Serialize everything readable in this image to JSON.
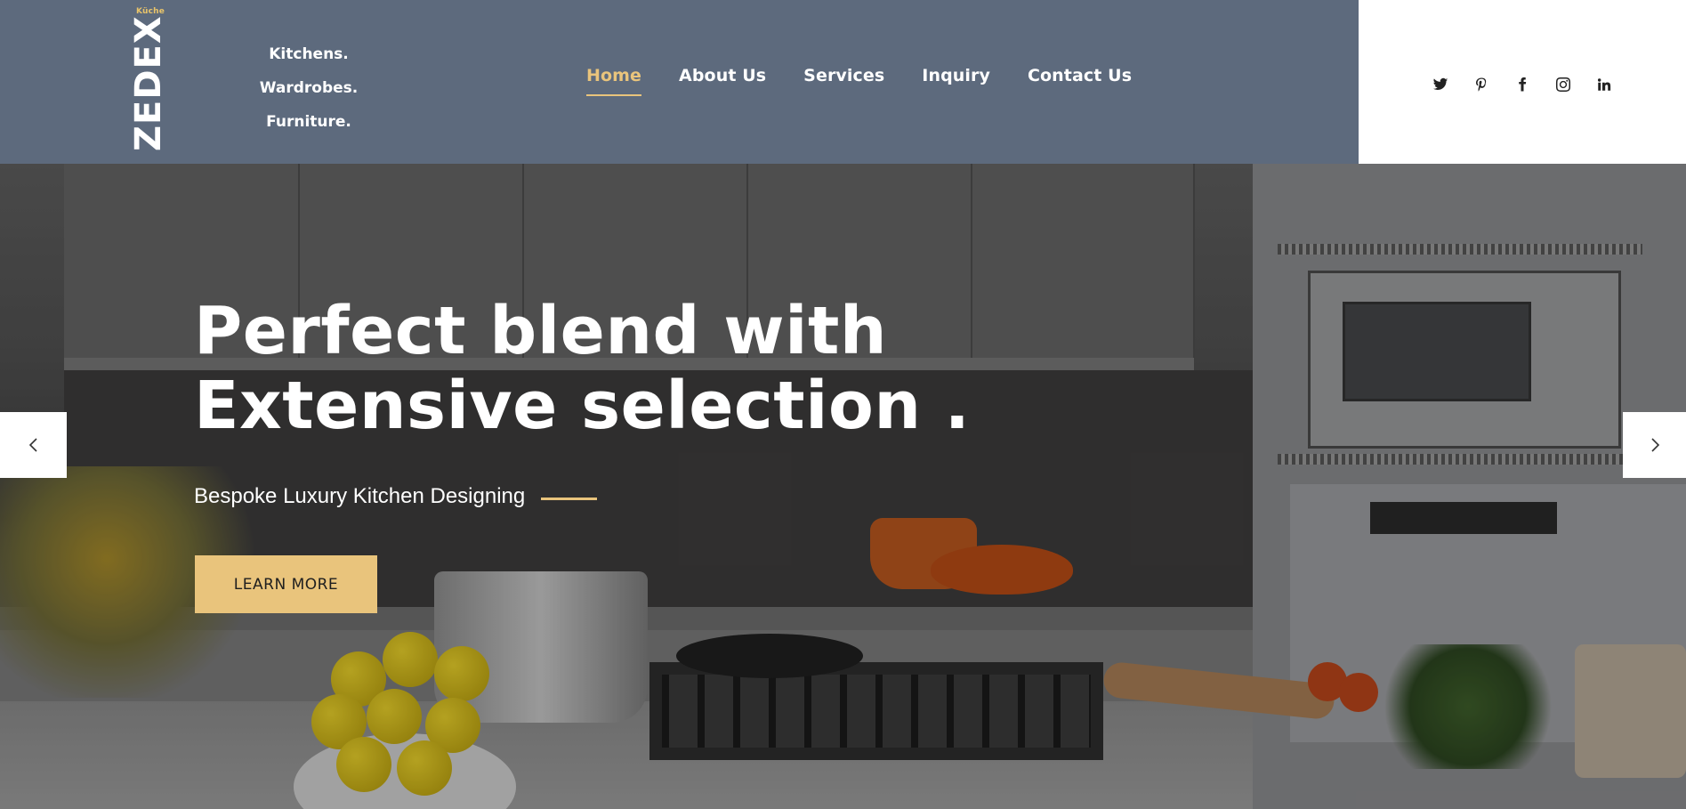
{
  "header": {
    "logo_small": "Küche",
    "logo_main": "ZEDEX",
    "tagline": [
      "Kitchens.",
      "Wardrobes.",
      "Furniture."
    ],
    "colors": {
      "header_bg": "#5d6a7d",
      "accent": "#e9c47c",
      "text": "#ffffff"
    }
  },
  "nav": {
    "items": [
      {
        "label": "Home",
        "active": true
      },
      {
        "label": "About Us",
        "active": false
      },
      {
        "label": "Services",
        "active": false
      },
      {
        "label": "Inquiry",
        "active": false
      },
      {
        "label": "Contact Us",
        "active": false
      }
    ]
  },
  "social": {
    "icons": [
      "twitter-icon",
      "pinterest-icon",
      "facebook-icon",
      "instagram-icon",
      "linkedin-icon"
    ]
  },
  "hero": {
    "title_line1": "Perfect blend with",
    "title_line2": "Extensive selection .",
    "subtitle": "Bespoke Luxury Kitchen Designing",
    "button_label": "LEARN MORE",
    "prev_icon": "chevron-left-icon",
    "next_icon": "chevron-right-icon"
  }
}
